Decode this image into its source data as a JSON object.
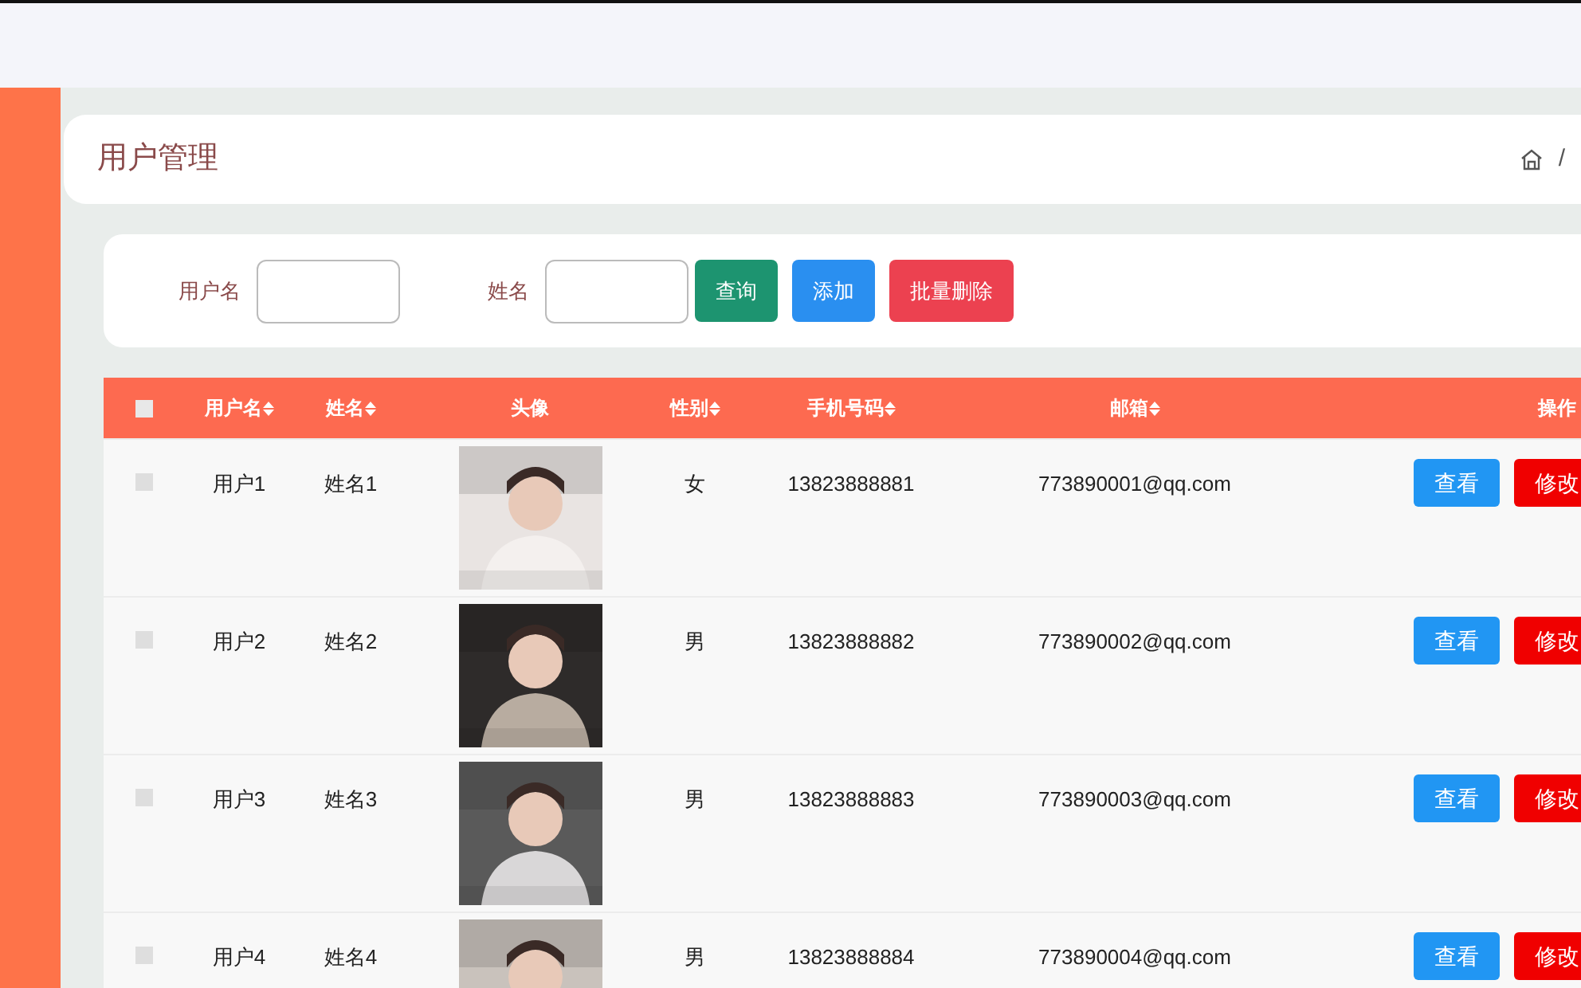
{
  "page_title": "用户管理",
  "breadcrumb": {
    "separator": "/"
  },
  "search": {
    "fields": [
      {
        "label": "用户名"
      },
      {
        "label": "姓名"
      }
    ],
    "buttons": [
      {
        "label": "查询",
        "kind": "query"
      },
      {
        "label": "添加",
        "kind": "add"
      },
      {
        "label": "批量删除",
        "kind": "delete"
      }
    ]
  },
  "table": {
    "select_all": {
      "checked": false
    },
    "columns": [
      {
        "label": "用户名",
        "sortable": true
      },
      {
        "label": "姓名",
        "sortable": true
      },
      {
        "label": "头像",
        "sortable": false
      },
      {
        "label": "性别",
        "sortable": true
      },
      {
        "label": "手机号码",
        "sortable": true
      },
      {
        "label": "邮箱",
        "sortable": true
      },
      {
        "label": "操作",
        "sortable": false
      }
    ],
    "rows": [
      {
        "checked": false,
        "username": "用户1",
        "name": "姓名1",
        "avatar": {
          "kind": "picture"
        },
        "gender": "女",
        "phone": "13823888881",
        "email": "773890001@qq.com",
        "actions": [
          {
            "label": "查看",
            "kind": "view"
          },
          {
            "label": "修改",
            "kind": "edit"
          }
        ]
      },
      {
        "checked": false,
        "username": "用户2",
        "name": "姓名2",
        "avatar": {
          "kind": "picture"
        },
        "gender": "男",
        "phone": "13823888882",
        "email": "773890002@qq.com",
        "actions": [
          {
            "label": "查看",
            "kind": "view"
          },
          {
            "label": "修改",
            "kind": "edit"
          }
        ]
      },
      {
        "checked": false,
        "username": "用户3",
        "name": "姓名3",
        "avatar": {
          "kind": "picture"
        },
        "gender": "男",
        "phone": "13823888883",
        "email": "773890003@qq.com",
        "actions": [
          {
            "label": "查看",
            "kind": "view"
          },
          {
            "label": "修改",
            "kind": "edit"
          }
        ]
      },
      {
        "checked": false,
        "username": "用户4",
        "name": "姓名4",
        "avatar": {
          "kind": "picture"
        },
        "gender": "男",
        "phone": "13823888884",
        "email": "773890004@qq.com",
        "actions": [
          {
            "label": "查看",
            "kind": "view"
          },
          {
            "label": "修改",
            "kind": "edit"
          }
        ]
      }
    ]
  }
}
